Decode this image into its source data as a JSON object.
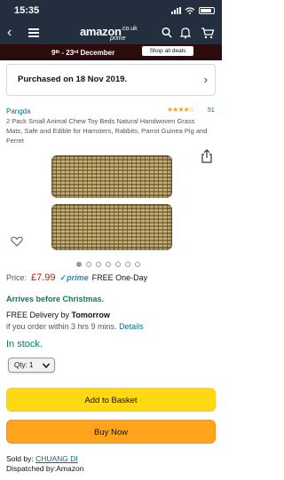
{
  "status_bar": {
    "time": "15:35"
  },
  "header": {
    "logo_main": "amazon",
    "logo_suffix": ".co.uk",
    "logo_prime": "prime",
    "icons": [
      "back-icon",
      "menu-icon",
      "search-icon",
      "bell-icon",
      "cart-icon"
    ]
  },
  "promo": {
    "date_range": "9ᵗʰ - 23ʳᵈ December",
    "button": "Shop all deals"
  },
  "purchased": {
    "text": "Purchased on 18 Nov 2019."
  },
  "product": {
    "brand": "Pangda",
    "stars": "★★★★☆",
    "rating_count": "51",
    "title": "2 Pack Small Animal Chew Toy Beds Natural Handwoven Grass Mats, Safe and Edible for Hamsters, Rabbits, Parrot Guinea Pig and Ferret",
    "image_count": 7,
    "active_image": 1
  },
  "price": {
    "label": "Price:",
    "value": "£7.99",
    "prime_check": "✓",
    "prime_word": "prime",
    "prime_text": "FREE One-Day"
  },
  "delivery": {
    "arrives": "Arrives before Christmas.",
    "free_delivery_prefix": "FREE Delivery by ",
    "free_delivery_day": "Tomorrow",
    "order_within": "if you order within 3 hrs 9 mins. ",
    "details_link": "Details"
  },
  "stock": {
    "status": "In stock."
  },
  "quantity": {
    "label": "Qty: 1"
  },
  "buttons": {
    "add_to_basket": "Add to Basket",
    "buy_now": "Buy Now"
  },
  "seller": {
    "sold_by_label": "Sold by: ",
    "sold_by_name": "CHUANG DI",
    "dispatched_label": "Dispatched by:",
    "dispatched_by": "Amazon"
  },
  "colors": {
    "header_bg": "#232f3e",
    "promo_bg": "#2b0b0b",
    "price": "#b12704",
    "in_stock": "#067d62",
    "link": "#007185",
    "basket_button": "#ffd814",
    "buy_button": "#ffa41c"
  }
}
